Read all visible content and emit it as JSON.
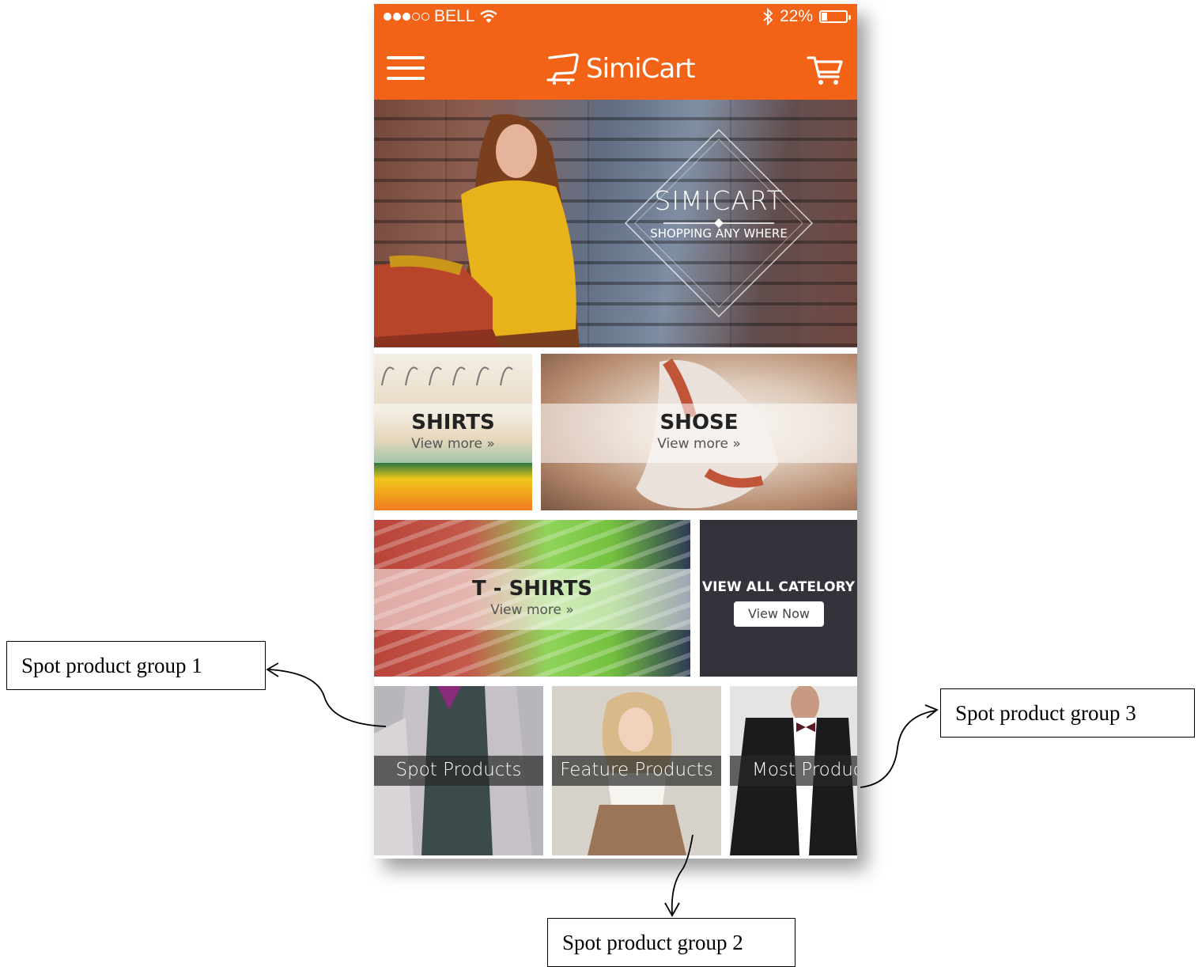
{
  "status_bar": {
    "carrier": "BELL",
    "battery_text": "22%",
    "battery_level": 0.22
  },
  "nav": {
    "logo_text": "SimiCart",
    "menu_icon": "hamburger-menu-icon",
    "cart_icon": "shopping-cart-icon"
  },
  "banner": {
    "title": "SIMICART",
    "subtitle": "SHOPPING ANY WHERE"
  },
  "categories": [
    {
      "name": "SHIRTS",
      "more": "View more »"
    },
    {
      "name": "SHOSE",
      "more": "View more »"
    },
    {
      "name": "T - SHIRTS",
      "more": "View more »"
    }
  ],
  "view_all": {
    "title": "VIEW ALL CATELORY",
    "button": "View Now"
  },
  "spot_groups": [
    {
      "label": "Spot Products"
    },
    {
      "label": "Feature Products"
    },
    {
      "label": "Most Produc"
    }
  ],
  "annotations": {
    "group1": "Spot product group 1",
    "group2": "Spot product group 2",
    "group3": "Spot product group 3"
  },
  "colors": {
    "brand_orange": "#f26318",
    "dark_tile": "#32333b"
  }
}
